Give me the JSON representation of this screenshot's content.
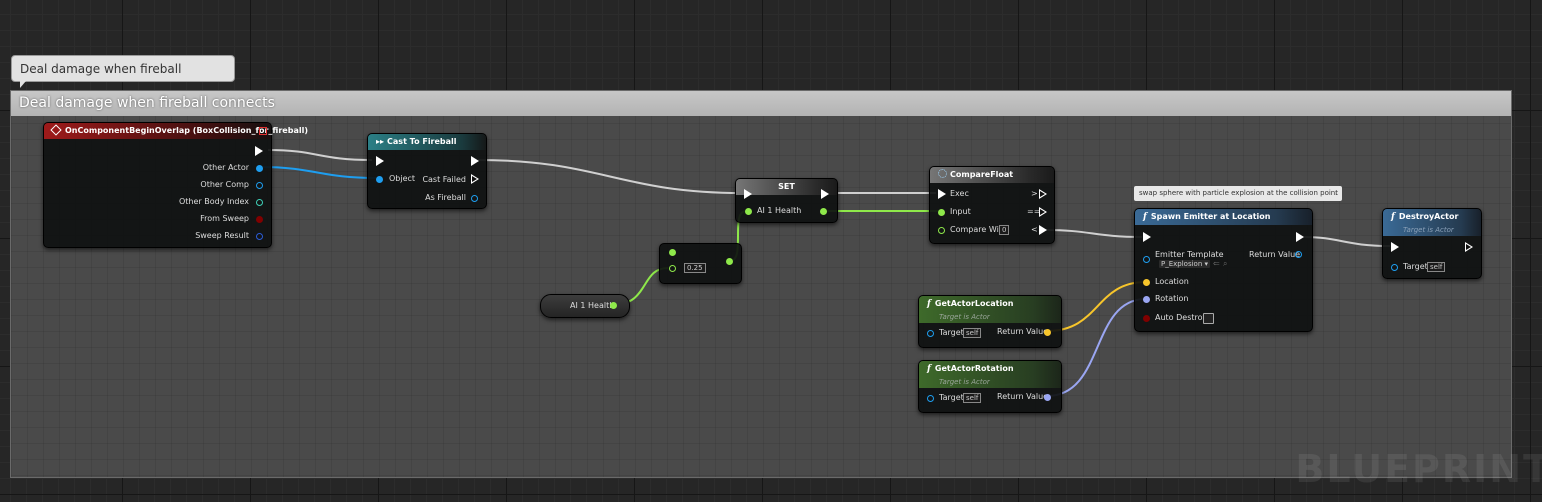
{
  "comment": {
    "bubble_text": "Deal damage when fireball connects",
    "title": "Deal damage when fireball connects"
  },
  "nodes": {
    "overlap": {
      "title": "OnComponentBeginOverlap (BoxCollision_for_fireball)",
      "pins": [
        "Other Actor",
        "Other Comp",
        "Other Body Index",
        "From Sweep",
        "Sweep Result"
      ]
    },
    "cast": {
      "title": "Cast To Fireball",
      "object": "Object",
      "cast_failed": "Cast Failed",
      "as_fireball": "As Fireball"
    },
    "set": {
      "title": "SET",
      "pin": "AI 1 Health"
    },
    "multiply": {
      "value": "0.25"
    },
    "get_health": {
      "label": "AI 1 Health"
    },
    "compare": {
      "title": "CompareFloat",
      "exec": "Exec",
      "input": "Input",
      "compare_with": "Compare With",
      "compare_value": "0",
      "out_gt": ">",
      "out_eq": "==",
      "out_lt": "<"
    },
    "get_location": {
      "title": "GetActorLocation",
      "subtitle": "Target is Actor",
      "target": "Target",
      "target_value": "self",
      "return": "Return Value"
    },
    "get_rotation": {
      "title": "GetActorRotation",
      "subtitle": "Target is Actor",
      "target": "Target",
      "target_value": "self",
      "return": "Return Value"
    },
    "spawn": {
      "comment": "swap sphere with particle explosion at the collision point",
      "title": "Spawn Emitter at Location",
      "emitter_template": "Emitter Template",
      "emitter_value": "P_Explosion",
      "return": "Return Value",
      "location": "Location",
      "rotation": "Rotation",
      "auto_destroy": "Auto Destroy"
    },
    "destroy": {
      "title": "DestroyActor",
      "subtitle": "Target is Actor",
      "target": "Target",
      "target_value": "self"
    }
  },
  "watermark": "BLUEPRINT",
  "colors": {
    "exec_wire": "#d0d0d0",
    "object_wire": "#1e9ef0",
    "float_wire": "#8ee84a",
    "vector_wire": "#f7c52b",
    "rotator_wire": "#9aa6f2"
  }
}
